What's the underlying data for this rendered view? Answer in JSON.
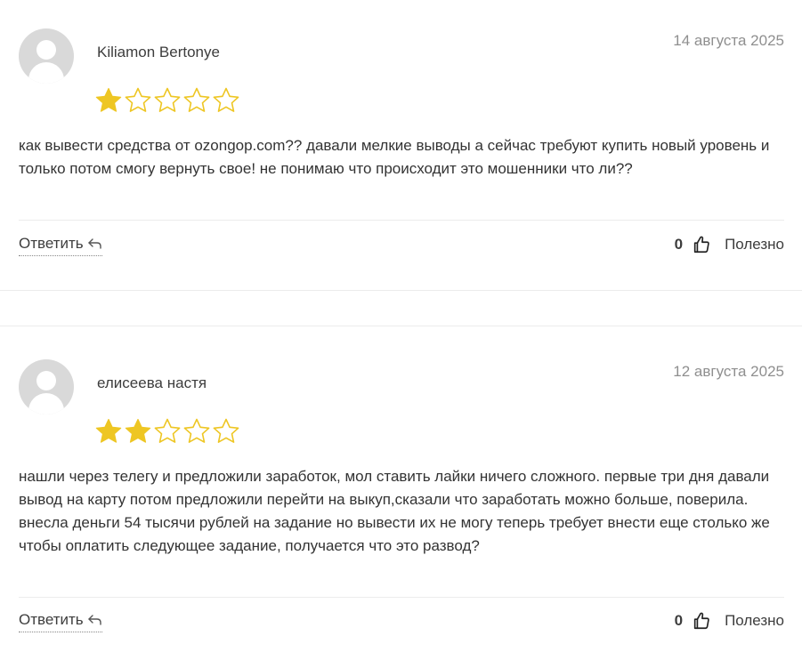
{
  "reviews": [
    {
      "author": "Kiliamon Bertonye",
      "date": "14 августа 2025",
      "rating": 1,
      "rating_max": 5,
      "text": "как вывести средства от ozongop.com?? давали мелкие выводы а сейчас требуют купить новый уровень и только потом смогу вернуть свое! не понимаю что происходит это мошенники что ли??",
      "reply_label": "Ответить",
      "helpful_count": "0",
      "helpful_label": "Полезно"
    },
    {
      "author": "елисеева настя",
      "date": "12 августа 2025",
      "rating": 2,
      "rating_max": 5,
      "text": "нашли через телегу и предложили заработок, мол ставить лайки ничего сложного. первые три дня давали вывод на карту потом предложили перейти на выкуп,сказали что заработать можно больше, поверила. внесла деньги 54 тысячи рублей на задание но вывести их не могу теперь требует внести еще столько же чтобы оплатить следующее задание, получается что это развод?",
      "reply_label": "Ответить",
      "helpful_count": "0",
      "helpful_label": "Полезно"
    }
  ],
  "colors": {
    "star_filled": "#eec623",
    "star_empty_stroke": "#eec623",
    "avatar_bg": "#d9d9d9",
    "date_text": "#8f8f8f"
  },
  "icons": {
    "reply": "reply-arrow-icon",
    "helpful": "thumbs-up-icon",
    "avatar": "user-placeholder-icon"
  }
}
